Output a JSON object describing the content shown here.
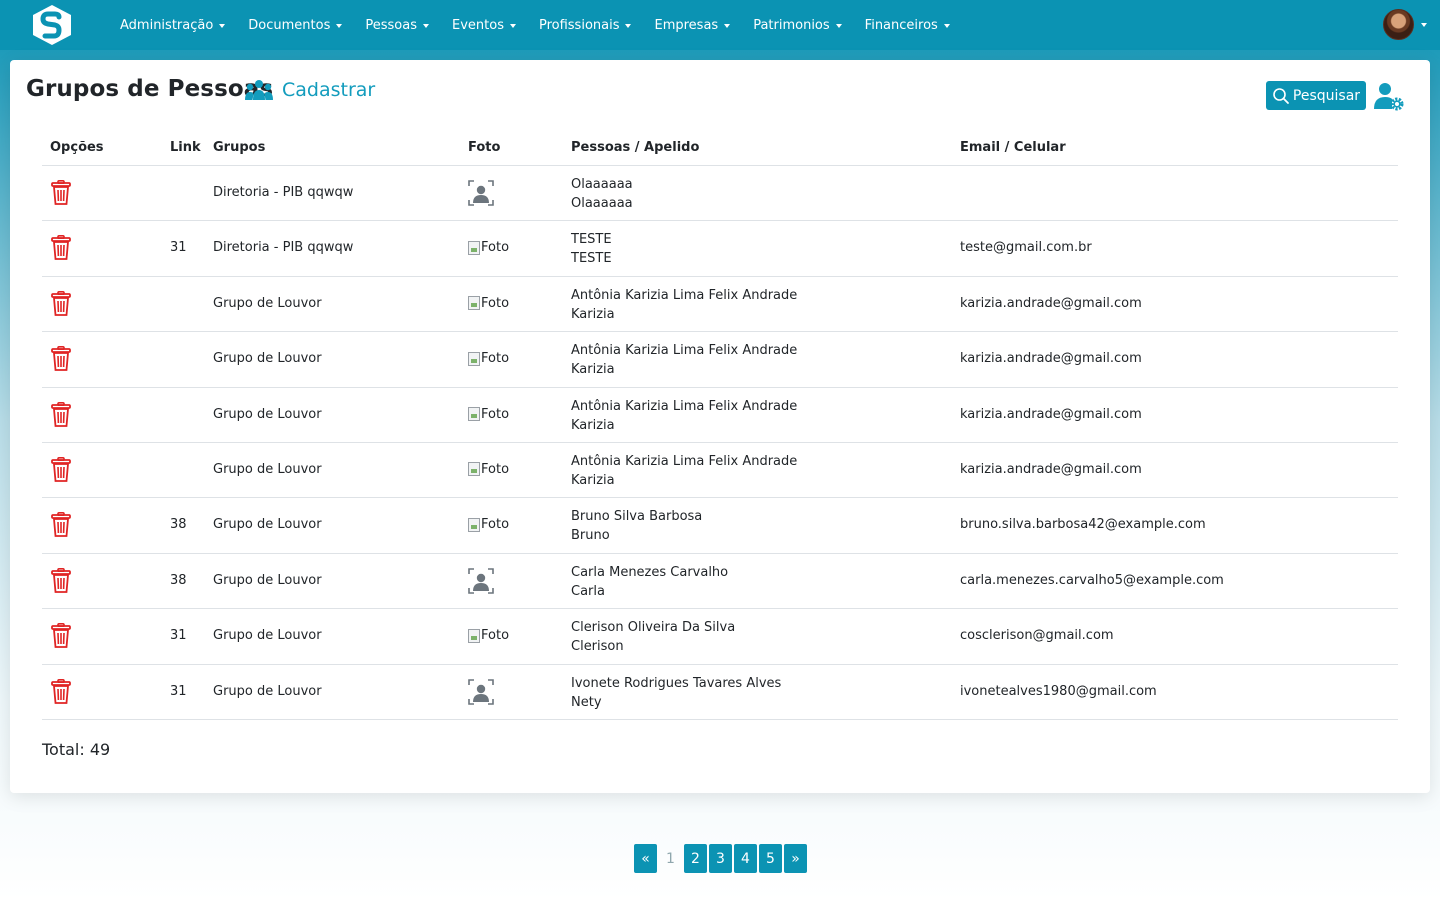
{
  "nav": {
    "brand_icon": "app-logo-icon",
    "items": [
      {
        "label": "Administração"
      },
      {
        "label": "Documentos"
      },
      {
        "label": "Pessoas"
      },
      {
        "label": "Eventos"
      },
      {
        "label": "Profissionais"
      },
      {
        "label": "Empresas"
      },
      {
        "label": "Patrimonios"
      },
      {
        "label": "Financeiros"
      }
    ]
  },
  "header": {
    "title": "Grupos de Pessoas",
    "add_label": "Cadastrar",
    "search_label": "Pesquisar"
  },
  "table": {
    "columns": {
      "options": "Opções",
      "link": "Link",
      "groups": "Grupos",
      "photo": "Foto",
      "people": "Pessoas / Apelido",
      "contact": "Email / Celular"
    },
    "rows": [
      {
        "link": "",
        "group": "Diretoria - PIB qqwqw",
        "photo": "placeholder",
        "photo_text": "",
        "name": "Olaaaaaa",
        "nickname": "Olaaaaaa",
        "email": ""
      },
      {
        "link": "31",
        "group": "Diretoria - PIB qqwqw",
        "photo": "broken",
        "photo_text": "Foto",
        "name": "TESTE",
        "nickname": "TESTE",
        "email": "teste@gmail.com.br"
      },
      {
        "link": "",
        "group": "Grupo de Louvor",
        "photo": "broken",
        "photo_text": "Foto",
        "name": "Antônia Karizia Lima Felix Andrade",
        "nickname": "Karizia",
        "email": "karizia.andrade@gmail.com"
      },
      {
        "link": "",
        "group": "Grupo de Louvor",
        "photo": "broken",
        "photo_text": "Foto",
        "name": "Antônia Karizia Lima Felix Andrade",
        "nickname": "Karizia",
        "email": "karizia.andrade@gmail.com"
      },
      {
        "link": "",
        "group": "Grupo de Louvor",
        "photo": "broken",
        "photo_text": "Foto",
        "name": "Antônia Karizia Lima Felix Andrade",
        "nickname": "Karizia",
        "email": "karizia.andrade@gmail.com"
      },
      {
        "link": "",
        "group": "Grupo de Louvor",
        "photo": "broken",
        "photo_text": "Foto",
        "name": "Antônia Karizia Lima Felix Andrade",
        "nickname": "Karizia",
        "email": "karizia.andrade@gmail.com"
      },
      {
        "link": "38",
        "group": "Grupo de Louvor",
        "photo": "broken",
        "photo_text": "Foto",
        "name": "Bruno Silva Barbosa",
        "nickname": "Bruno",
        "email": "bruno.silva.barbosa42@example.com"
      },
      {
        "link": "38",
        "group": "Grupo de Louvor",
        "photo": "placeholder",
        "photo_text": "",
        "name": "Carla Menezes Carvalho",
        "nickname": "Carla",
        "email": "carla.menezes.carvalho5@example.com"
      },
      {
        "link": "31",
        "group": "Grupo de Louvor",
        "photo": "broken",
        "photo_text": "Foto",
        "name": "Clerison Oliveira Da Silva",
        "nickname": "Clerison",
        "email": "cosclerison@gmail.com"
      },
      {
        "link": "31",
        "group": "Grupo de Louvor",
        "photo": "placeholder",
        "photo_text": "",
        "name": "Ivonete Rodrigues Tavares Alves",
        "nickname": "Nety",
        "email": "ivonetealves1980@gmail.com"
      }
    ]
  },
  "total": "Total: 49",
  "pagination": {
    "prev": "«",
    "pages": [
      "1",
      "2",
      "3",
      "4",
      "5"
    ],
    "current": "1",
    "next": "»"
  },
  "colors": {
    "primary": "#0b93b3",
    "link": "#139cbd",
    "danger": "#e02424"
  }
}
